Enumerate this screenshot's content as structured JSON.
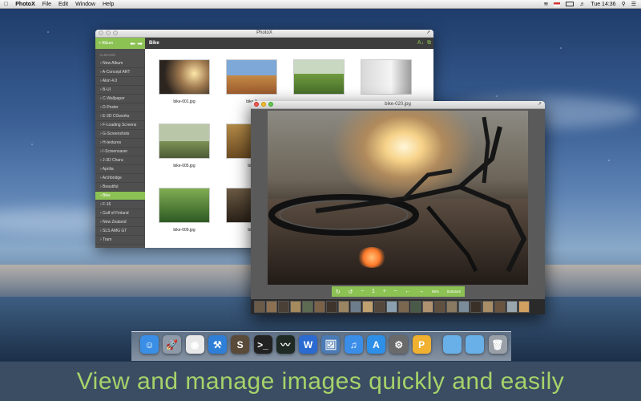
{
  "menubar": {
    "apple_icon": "apple-icon",
    "items": [
      "PhotoX",
      "File",
      "Edit",
      "Window",
      "Help"
    ],
    "clock": "Tue 14:36",
    "status_icons": [
      "wifi-icon",
      "flag-icon",
      "battery-icon",
      "volume-icon",
      "search-icon",
      "list-icon"
    ]
  },
  "library_window": {
    "title": "PhotoX",
    "albums_button": "+ Album",
    "current_album": "Bike",
    "sidebar_heading": "ALBUMS",
    "albums": [
      "New Album",
      "A-Concept ART",
      "Alon 4.0",
      "B-UI",
      "C-Wallpaper",
      "D-Poster",
      "E-3D CGworks",
      "F-Loading Screens",
      "G-Screenshots",
      "H-textures",
      "I-Screensaver",
      "J-3D Chara",
      "Aprilia",
      "Archbridge",
      "Beautiful",
      "Bike",
      "F-16",
      "Gulf of Finland",
      "New Zealand",
      "SLS AMG GT",
      "Tram"
    ],
    "selected_album": "Bike",
    "thumbnails": [
      "bike-001.jpg",
      "bike-0",
      "bike-005.jpg",
      "bike",
      "bike-009.jpg",
      "bike"
    ]
  },
  "viewer_window": {
    "title": "bike-020.jpg",
    "zoom": "95%",
    "size_label": "820x546",
    "toolbar_icons": [
      "rotate-left-icon",
      "rotate-right-icon",
      "minus-icon",
      "one-to-one-icon",
      "plus-icon",
      "minus-icon",
      "previous-icon",
      "next-icon"
    ]
  },
  "dock": {
    "icons": [
      "finder-icon",
      "launchpad-icon",
      "chrome-icon",
      "xcode-icon",
      "sublime-icon",
      "terminal-icon",
      "activity-monitor-icon",
      "word-icon",
      "preview-icon",
      "itunes-icon",
      "app-store-icon",
      "system-preferences-icon",
      "photox-icon",
      "folder-icon",
      "folder-icon",
      "trash-icon"
    ]
  },
  "banner": {
    "text": "View and manage images quickly and easily"
  },
  "colors": {
    "accent": "#8cc153",
    "banner_bg": "#3a4d63",
    "banner_text": "#a6d36a"
  }
}
